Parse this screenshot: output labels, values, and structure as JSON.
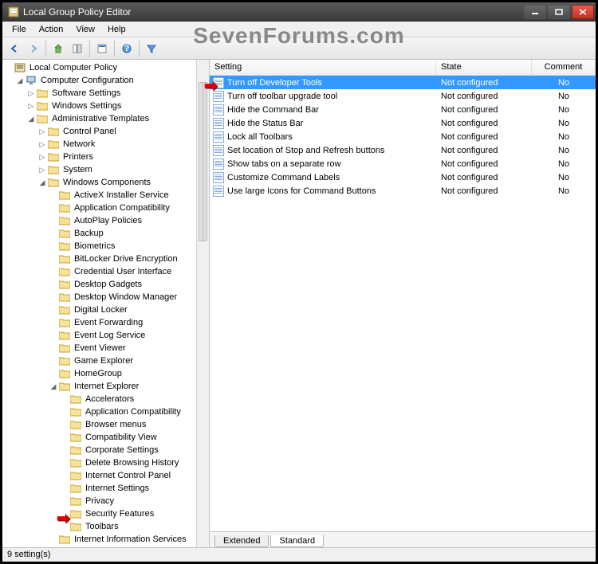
{
  "watermark": "SevenForums.com",
  "titlebar": {
    "title": "Local Group Policy Editor"
  },
  "menubar": {
    "items": [
      "File",
      "Action",
      "View",
      "Help"
    ]
  },
  "tree": {
    "root": {
      "label": "Local Computer Policy",
      "icon": "policy"
    },
    "cc": {
      "label": "Computer Configuration",
      "icon": "computer"
    },
    "ss": {
      "label": "Software Settings"
    },
    "ws": {
      "label": "Windows Settings"
    },
    "at": {
      "label": "Administrative Templates"
    },
    "at_children": [
      "Control Panel",
      "Network",
      "Printers",
      "System"
    ],
    "wc": {
      "label": "Windows Components"
    },
    "wc_children": [
      "ActiveX Installer Service",
      "Application Compatibility",
      "AutoPlay Policies",
      "Backup",
      "Biometrics",
      "BitLocker Drive Encryption",
      "Credential User Interface",
      "Desktop Gadgets",
      "Desktop Window Manager",
      "Digital Locker",
      "Event Forwarding",
      "Event Log Service",
      "Event Viewer",
      "Game Explorer",
      "HomeGroup"
    ],
    "ie": {
      "label": "Internet Explorer"
    },
    "ie_children": [
      "Accelerators",
      "Application Compatibility",
      "Browser menus",
      "Compatibility View",
      "Corporate Settings",
      "Delete Browsing History",
      "Internet Control Panel",
      "Internet Settings",
      "Privacy",
      "Security Features",
      "Toolbars"
    ],
    "iis": {
      "label": "Internet Information Services"
    }
  },
  "list": {
    "headers": {
      "setting": "Setting",
      "state": "State",
      "comment": "Comment"
    },
    "rows": [
      {
        "setting": "Turn off Developer Tools",
        "state": "Not configured",
        "comment": "No",
        "selected": true
      },
      {
        "setting": "Turn off toolbar upgrade tool",
        "state": "Not configured",
        "comment": "No"
      },
      {
        "setting": "Hide the Command Bar",
        "state": "Not configured",
        "comment": "No"
      },
      {
        "setting": "Hide the Status Bar",
        "state": "Not configured",
        "comment": "No"
      },
      {
        "setting": "Lock all Toolbars",
        "state": "Not configured",
        "comment": "No"
      },
      {
        "setting": "Set location of Stop and Refresh buttons",
        "state": "Not configured",
        "comment": "No"
      },
      {
        "setting": "Show tabs on a separate row",
        "state": "Not configured",
        "comment": "No"
      },
      {
        "setting": "Customize Command Labels",
        "state": "Not configured",
        "comment": "No"
      },
      {
        "setting": "Use large Icons for Command Buttons",
        "state": "Not configured",
        "comment": "No"
      }
    ]
  },
  "tabs": {
    "extended": "Extended",
    "standard": "Standard"
  },
  "statusbar": {
    "text": "9 setting(s)"
  }
}
